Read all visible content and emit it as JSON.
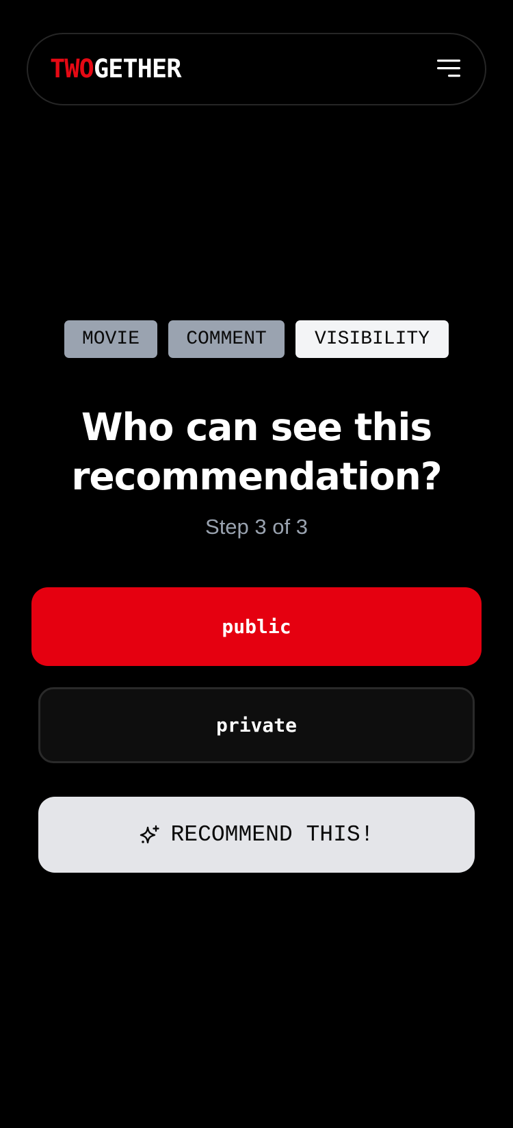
{
  "header": {
    "logo_part1": "TWO",
    "logo_part2": "GETHER",
    "menu_icon": "hamburger-menu-icon"
  },
  "steps": [
    {
      "label": "MOVIE",
      "state": "done"
    },
    {
      "label": "COMMENT",
      "state": "done"
    },
    {
      "label": "VISIBILITY",
      "state": "active"
    }
  ],
  "main": {
    "title": "Who can see this recommendation?",
    "subtitle": "Step 3 of 3"
  },
  "options": [
    {
      "label": "public",
      "selected": true
    },
    {
      "label": "private",
      "selected": false
    }
  ],
  "cta": {
    "label": "RECOMMEND THIS!",
    "icon": "sparkles-icon"
  },
  "colors": {
    "background": "#000000",
    "brand_red": "#e50914",
    "selected_option": "#e50010",
    "step_done": "#9aa3b0",
    "step_active": "#f3f4f6",
    "subtitle": "#9aa3b0",
    "cta_background": "#e4e5e9"
  }
}
